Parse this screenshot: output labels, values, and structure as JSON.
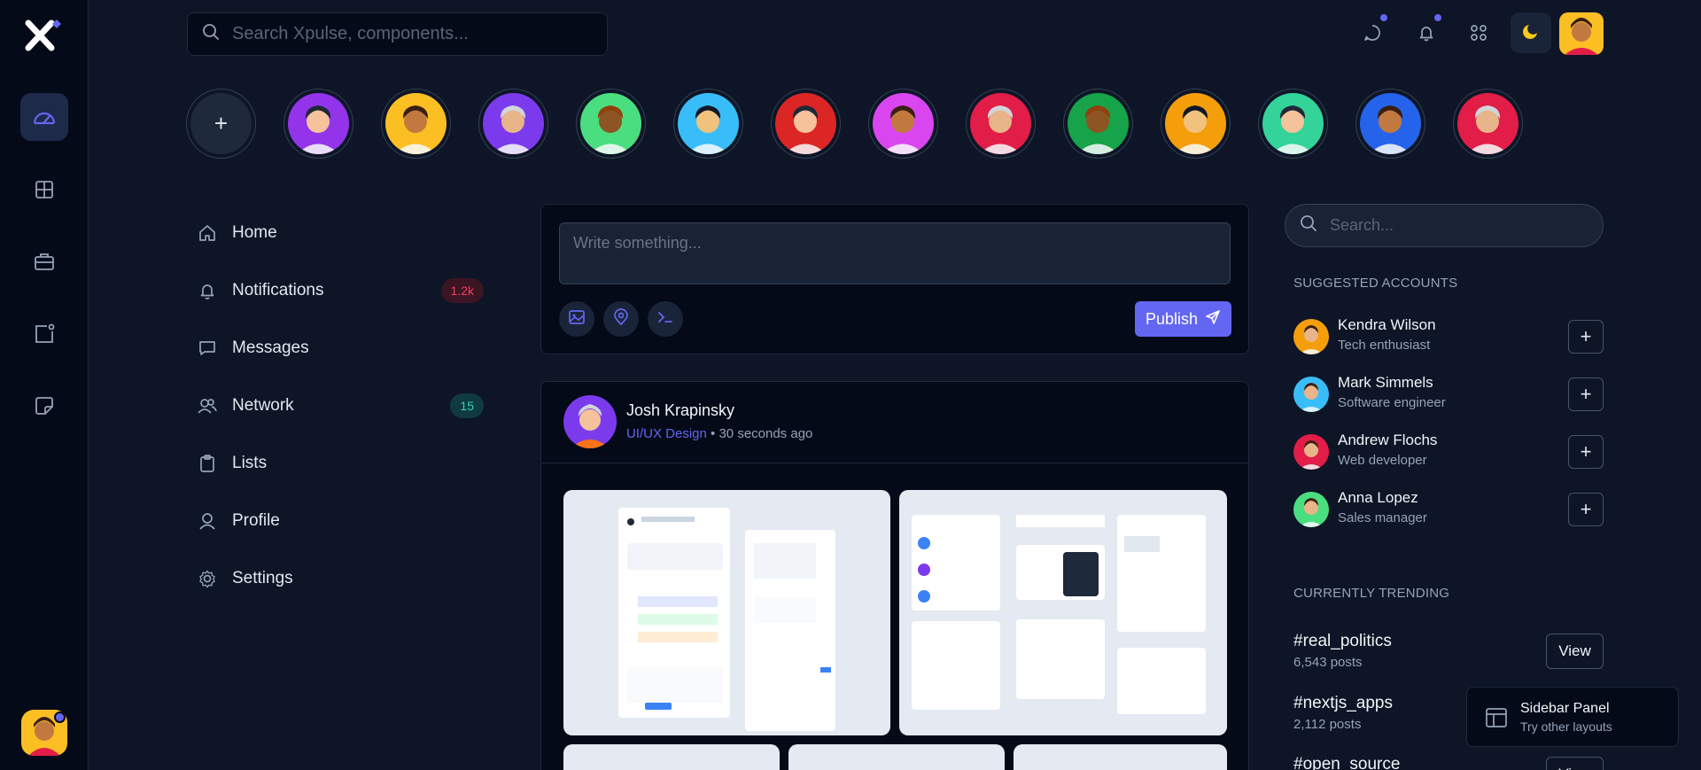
{
  "topbar": {
    "search_placeholder": "Search Xpulse, components..."
  },
  "stories": [
    {
      "bg": "#9333ea"
    },
    {
      "bg": "#fbbf24"
    },
    {
      "bg": "#7c3aed"
    },
    {
      "bg": "#4ade80"
    },
    {
      "bg": "#38bdf8"
    },
    {
      "bg": "#dc2626"
    },
    {
      "bg": "#d946ef"
    },
    {
      "bg": "#e11d48"
    },
    {
      "bg": "#16a34a"
    },
    {
      "bg": "#f59e0b"
    },
    {
      "bg": "#34d399"
    },
    {
      "bg": "#2563eb"
    },
    {
      "bg": "#e11d48"
    }
  ],
  "menu": {
    "home": "Home",
    "notifications": "Notifications",
    "notifications_badge": "1.2k",
    "messages": "Messages",
    "network": "Network",
    "network_badge": "15",
    "lists": "Lists",
    "profile": "Profile",
    "settings": "Settings"
  },
  "composer": {
    "placeholder": "Write something...",
    "publish_label": "Publish"
  },
  "post": {
    "author": "Josh Krapinsky",
    "tag": "UI/UX Design",
    "time": " • 30 seconds ago"
  },
  "right": {
    "search_placeholder": "Search...",
    "suggested_title": "SUGGESTED ACCOUNTS",
    "accounts": [
      {
        "name": "Kendra Wilson",
        "role": "Tech enthusiast",
        "color": "#f59e0b"
      },
      {
        "name": "Mark Simmels",
        "role": "Software engineer",
        "color": "#38bdf8"
      },
      {
        "name": "Andrew Flochs",
        "role": "Web developer",
        "color": "#e11d48"
      },
      {
        "name": "Anna Lopez",
        "role": "Sales manager",
        "color": "#4ade80"
      }
    ],
    "trending_title": "CURRENTLY TRENDING",
    "trends": [
      {
        "tag": "#real_politics",
        "count": "6,543 posts"
      },
      {
        "tag": "#nextjs_apps",
        "count": "2,112 posts"
      },
      {
        "tag": "#open_source",
        "count": ""
      }
    ],
    "view_label": "View"
  },
  "panel": {
    "title": "Sidebar Panel",
    "subtitle": "Try other layouts"
  },
  "colors": {
    "accent": "#6366f1",
    "bg": "#0d1526",
    "surface": "#050a18"
  }
}
